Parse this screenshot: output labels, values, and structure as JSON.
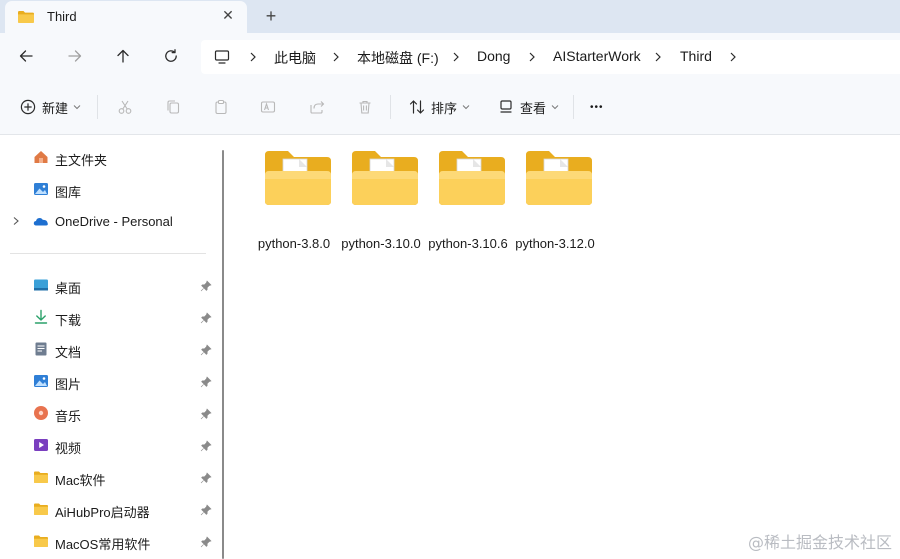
{
  "window": {
    "tab_title": "Third",
    "tab_close_glyph": "✕",
    "new_tab_glyph": "+"
  },
  "nav": {
    "back_icon": "back-arrow-icon",
    "forward_icon": "forward-arrow-icon",
    "up_icon": "up-arrow-icon",
    "refresh_icon": "refresh-icon"
  },
  "breadcrumb": [
    "此电脑",
    "本地磁盘 (F:)",
    "Dong",
    "AIStarterWork",
    "Third"
  ],
  "commandbar": {
    "new_label": "新建",
    "sort_label": "排序",
    "view_label": "查看",
    "more_glyph": "•••"
  },
  "sidebar": {
    "top_items": [
      {
        "label": "主文件夹",
        "icon": "home-icon"
      },
      {
        "label": "图库",
        "icon": "gallery-icon"
      },
      {
        "label": "OneDrive - Personal",
        "icon": "onedrive-icon"
      }
    ],
    "pinned_items": [
      {
        "label": "桌面",
        "icon": "desktop-icon"
      },
      {
        "label": "下载",
        "icon": "download-icon"
      },
      {
        "label": "文档",
        "icon": "document-icon"
      },
      {
        "label": "图片",
        "icon": "pictures-icon"
      },
      {
        "label": "音乐",
        "icon": "music-icon"
      },
      {
        "label": "视频",
        "icon": "video-icon"
      },
      {
        "label": "Mac软件",
        "icon": "folder-icon"
      },
      {
        "label": "AiHubPro启动器",
        "icon": "folder-icon"
      },
      {
        "label": "MacOS常用软件",
        "icon": "folder-icon"
      }
    ]
  },
  "files": [
    {
      "name": "python-3.8.0"
    },
    {
      "name": "python-3.10.0"
    },
    {
      "name": "python-3.10.6"
    },
    {
      "name": "python-3.12.0"
    }
  ],
  "watermark": "@稀土掘金技术社区",
  "colors": {
    "tabstrip_bg": "#dde6f2",
    "chrome_bg": "#f7f9fc",
    "folder_yellow": "#f8c94a",
    "folder_dark": "#e9ad1f"
  }
}
